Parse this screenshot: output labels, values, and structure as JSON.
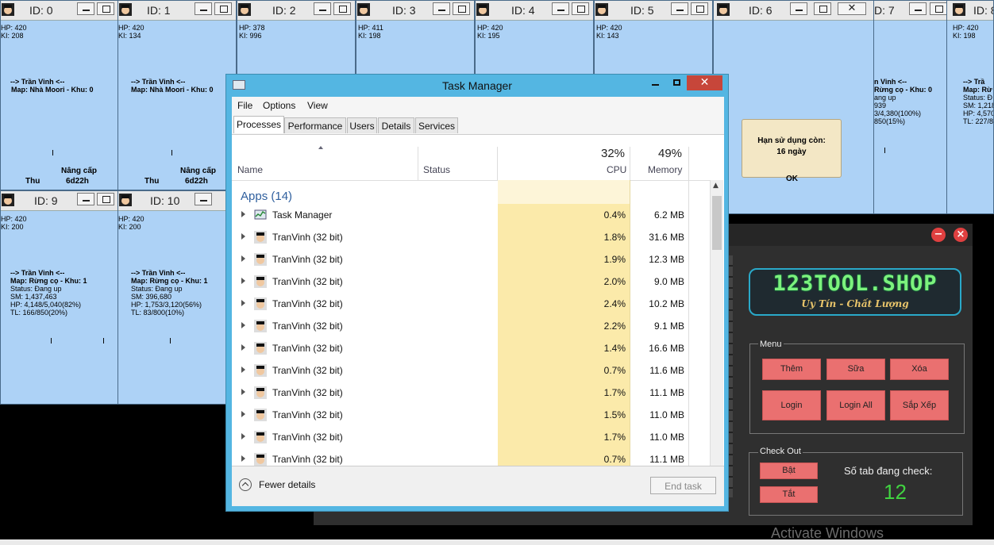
{
  "game_windows": [
    {
      "id": "ID: 0",
      "hp": "HP: 420",
      "ki": "KI: 208",
      "name": "--> Trần Vinh <--",
      "map": "Map: Nhà Moori - Khu: 0",
      "lower": [
        "Thu",
        "Nâng cấp",
        "6d22h"
      ]
    },
    {
      "id": "ID: 1",
      "hp": "HP: 420",
      "ki": "KI: 134",
      "name": "--> Trần Vinh <--",
      "map": "Map: Nhà Moori - Khu: 0",
      "lower": [
        "Thu",
        "Nâng cấp",
        "6d22h"
      ]
    },
    {
      "id": "ID: 2",
      "hp": "HP: 378",
      "ki": "KI: 996"
    },
    {
      "id": "ID: 3",
      "hp": "HP: 411",
      "ki": "KI: 198"
    },
    {
      "id": "ID: 4",
      "hp": "HP: 420",
      "ki": "KI: 195"
    },
    {
      "id": "ID: 5",
      "hp": "HP: 420",
      "ki": "KI: 143"
    },
    {
      "id": "ID: 6"
    },
    {
      "id": "D: 7",
      "name": "n Vinh <--",
      "map": "Rừng cọ - Khu: 0",
      "s1": "ang up",
      "s2": "939",
      "s3": "3/4,380(100%)",
      "s4": "850(15%)"
    },
    {
      "id": "ID: 8",
      "hp": "HP: 420",
      "ki": "KI: 198",
      "name": "--> Trầ",
      "map": "Map: Rừ",
      "s1": "Status: Đ",
      "s2": "SM: 1,218",
      "s3": "HP: 4,570",
      "s4": "TL: 227/8"
    },
    {
      "id": "ID: 9",
      "hp": "HP: 420",
      "ki": "KI: 200",
      "name": "--> Trần Vinh <--",
      "map": "Map: Rừng cọ - Khu: 1",
      "s1": "Status: Đang up",
      "s2": "SM: 1,437,463",
      "s3": "HP: 4,148/5,040(82%)",
      "s4": "TL: 166/850(20%)"
    },
    {
      "id": "ID: 10",
      "hp": "HP: 420",
      "ki": "KI: 200",
      "name": "--> Trần Vinh <--",
      "map": "Map: Rừng cọ - Khu: 1",
      "s1": "Status: Đang up",
      "s2": "SM: 396,680",
      "s3": "HP: 1,753/3,120(56%)",
      "s4": "TL: 83/800(10%)"
    }
  ],
  "notice": {
    "line1": "Hạn sử dụng còn:",
    "line2": "16 ngày",
    "ok": "OK"
  },
  "task_manager": {
    "title": "Task Manager",
    "menu": [
      "File",
      "Options",
      "View"
    ],
    "tabs": [
      "Processes",
      "Performance",
      "Users",
      "Details",
      "Services"
    ],
    "columns": {
      "name": "Name",
      "status": "Status",
      "cpu_pct": "32%",
      "cpu": "CPU",
      "mem_pct": "49%",
      "mem": "Memory"
    },
    "group": "Apps (14)",
    "rows": [
      {
        "name": "Task Manager",
        "cpu": "0.4%",
        "mem": "6.2 MB",
        "icon": "task-manager-icon"
      },
      {
        "name": "TranVinh (32 bit)",
        "cpu": "1.8%",
        "mem": "31.6 MB",
        "icon": "game-avatar-icon"
      },
      {
        "name": "TranVinh (32 bit)",
        "cpu": "1.9%",
        "mem": "12.3 MB",
        "icon": "game-avatar-icon"
      },
      {
        "name": "TranVinh (32 bit)",
        "cpu": "2.0%",
        "mem": "9.0 MB",
        "icon": "game-avatar-icon"
      },
      {
        "name": "TranVinh (32 bit)",
        "cpu": "2.4%",
        "mem": "10.2 MB",
        "icon": "game-avatar-icon"
      },
      {
        "name": "TranVinh (32 bit)",
        "cpu": "2.2%",
        "mem": "9.1 MB",
        "icon": "game-avatar-icon"
      },
      {
        "name": "TranVinh (32 bit)",
        "cpu": "1.4%",
        "mem": "16.6 MB",
        "icon": "game-avatar-icon"
      },
      {
        "name": "TranVinh (32 bit)",
        "cpu": "0.7%",
        "mem": "11.6 MB",
        "icon": "game-avatar-icon"
      },
      {
        "name": "TranVinh (32 bit)",
        "cpu": "1.7%",
        "mem": "11.1 MB",
        "icon": "game-avatar-icon"
      },
      {
        "name": "TranVinh (32 bit)",
        "cpu": "1.5%",
        "mem": "11.0 MB",
        "icon": "game-avatar-icon"
      },
      {
        "name": "TranVinh (32 bit)",
        "cpu": "1.7%",
        "mem": "11.0 MB",
        "icon": "game-avatar-icon"
      },
      {
        "name": "TranVinh (32 bit)",
        "cpu": "0.7%",
        "mem": "11.1 MB",
        "icon": "game-avatar-icon"
      }
    ],
    "fewer": "Fewer details",
    "end_task": "End task"
  },
  "tool": {
    "logo1": "123TOOL.SHOP",
    "logo2": "Uy Tín - Chất Lượng",
    "menu_label": "Menu",
    "buttons": {
      "add": "Thêm",
      "edit": "Sữa",
      "delete": "Xóa",
      "login": "Login",
      "login_all": "Login All",
      "arrange": "Sắp Xếp"
    },
    "checkout_label": "Check Out",
    "on": "Bật",
    "off": "Tắt",
    "tab_count_label": "Số tab đang check:",
    "tab_count": "12"
  },
  "watermark": "Activate Windows",
  "colors": {
    "game_bg": "#add2f6",
    "tm_title": "#54b6e2",
    "tool_bg": "#2f2f2f",
    "button_red": "#ea7070",
    "count_green": "#41d341",
    "close_red": "#c7463a"
  }
}
